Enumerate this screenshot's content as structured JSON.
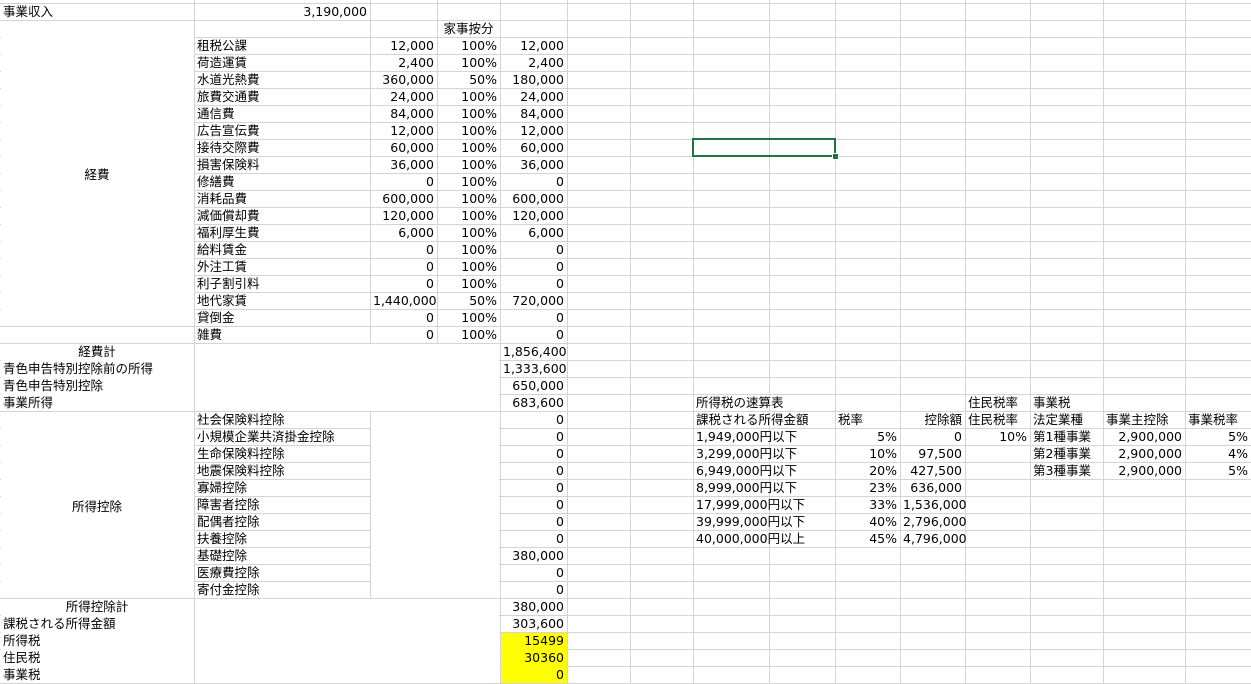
{
  "income": {
    "label": "事業収入",
    "value": "3,190,000"
  },
  "expenses": {
    "group_label": "経費",
    "kaji_header": "家事按分",
    "rows": [
      {
        "name": "租税公課",
        "amount": "12,000",
        "ratio": "100%",
        "result": "12,000"
      },
      {
        "name": "荷造運賃",
        "amount": "2,400",
        "ratio": "100%",
        "result": "2,400"
      },
      {
        "name": "水道光熱費",
        "amount": "360,000",
        "ratio": "50%",
        "result": "180,000"
      },
      {
        "name": "旅費交通費",
        "amount": "24,000",
        "ratio": "100%",
        "result": "24,000"
      },
      {
        "name": "通信費",
        "amount": "84,000",
        "ratio": "100%",
        "result": "84,000"
      },
      {
        "name": "広告宣伝費",
        "amount": "12,000",
        "ratio": "100%",
        "result": "12,000"
      },
      {
        "name": "接待交際費",
        "amount": "60,000",
        "ratio": "100%",
        "result": "60,000"
      },
      {
        "name": "損害保険料",
        "amount": "36,000",
        "ratio": "100%",
        "result": "36,000"
      },
      {
        "name": "修繕費",
        "amount": "0",
        "ratio": "100%",
        "result": "0"
      },
      {
        "name": "消耗品費",
        "amount": "600,000",
        "ratio": "100%",
        "result": "600,000"
      },
      {
        "name": "減価償却費",
        "amount": "120,000",
        "ratio": "100%",
        "result": "120,000"
      },
      {
        "name": "福利厚生費",
        "amount": "6,000",
        "ratio": "100%",
        "result": "6,000"
      },
      {
        "name": "給料賃金",
        "amount": "0",
        "ratio": "100%",
        "result": "0"
      },
      {
        "name": "外注工賃",
        "amount": "0",
        "ratio": "100%",
        "result": "0"
      },
      {
        "name": "利子割引料",
        "amount": "0",
        "ratio": "100%",
        "result": "0"
      },
      {
        "name": "地代家賃",
        "amount": "1,440,000",
        "ratio": "50%",
        "result": "720,000"
      },
      {
        "name": "貸倒金",
        "amount": "0",
        "ratio": "100%",
        "result": "0"
      },
      {
        "name": "雑費",
        "amount": "0",
        "ratio": "100%",
        "result": "0"
      }
    ]
  },
  "summary1": [
    {
      "label": "経費計",
      "value": "1,856,400"
    },
    {
      "label": "青色申告特別控除前の所得",
      "value": "1,333,600"
    },
    {
      "label": "青色申告特別控除",
      "value": "650,000"
    },
    {
      "label": "事業所得",
      "value": "683,600"
    }
  ],
  "deductions": {
    "group_label": "所得控除",
    "rows": [
      {
        "name": "社会保険料控除",
        "value": "0"
      },
      {
        "name": "小規模企業共済掛金控除",
        "value": "0"
      },
      {
        "name": "生命保険料控除",
        "value": "0"
      },
      {
        "name": "地震保険料控除",
        "value": "0"
      },
      {
        "name": "寡婦控除",
        "value": "0"
      },
      {
        "name": "障害者控除",
        "value": "0"
      },
      {
        "name": "配偶者控除",
        "value": "0"
      },
      {
        "name": "扶養控除",
        "value": "0"
      },
      {
        "name": "基礎控除",
        "value": "380,000"
      },
      {
        "name": "医療費控除",
        "value": "0"
      },
      {
        "name": "寄付金控除",
        "value": "0"
      }
    ]
  },
  "summary2": [
    {
      "label": "所得控除計",
      "value": "380,000"
    },
    {
      "label": "課税される所得金額",
      "value": "303,600"
    },
    {
      "label": "所得税",
      "value": "15499"
    },
    {
      "label": "住民税",
      "value": "30360"
    },
    {
      "label": "事業税",
      "value": "0"
    }
  ],
  "quick_table": {
    "title": "所得税の速算表",
    "headers": [
      "課税される所得金額",
      "税率",
      "控除額"
    ],
    "rows": [
      {
        "bracket": "1,949,000円以下",
        "rate": "5%",
        "deduction": "0"
      },
      {
        "bracket": "3,299,000円以下",
        "rate": "10%",
        "deduction": "97,500"
      },
      {
        "bracket": "6,949,000円以下",
        "rate": "20%",
        "deduction": "427,500"
      },
      {
        "bracket": "8,999,000円以下",
        "rate": "23%",
        "deduction": "636,000"
      },
      {
        "bracket": "17,999,000円以下",
        "rate": "33%",
        "deduction": "1,536,000"
      },
      {
        "bracket": "39,999,000円以下",
        "rate": "40%",
        "deduction": "2,796,000"
      },
      {
        "bracket": "40,000,000円以上",
        "rate": "45%",
        "deduction": "4,796,000"
      }
    ]
  },
  "resident_tax": {
    "title": "住民税率",
    "header": "住民税率",
    "value": "10%"
  },
  "business_tax": {
    "title": "事業税",
    "headers": [
      "法定業種",
      "事業主控除",
      "事業税率"
    ],
    "rows": [
      {
        "type": "第1種事業",
        "deduction": "2,900,000",
        "rate": "5%"
      },
      {
        "type": "第2種事業",
        "deduction": "2,900,000",
        "rate": "4%"
      },
      {
        "type": "第3種事業",
        "deduction": "2,900,000",
        "rate": "5%"
      }
    ]
  },
  "colors": {
    "highlight": "#ffff00",
    "selection": "#217346",
    "grid": "#d4d4d4"
  }
}
